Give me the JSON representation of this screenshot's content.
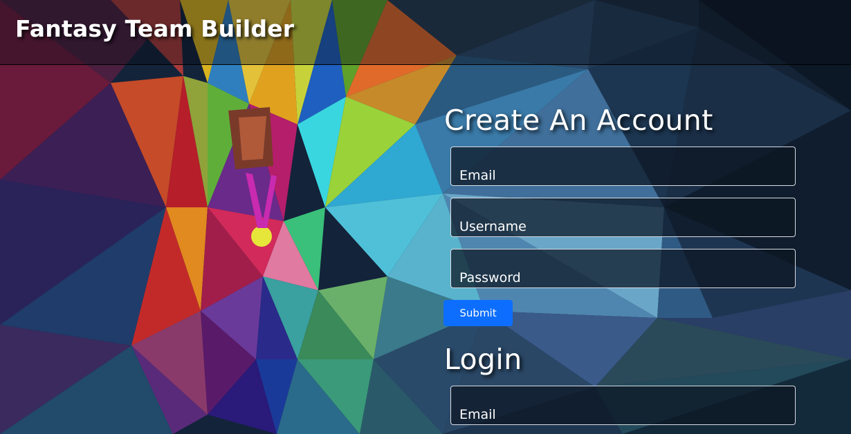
{
  "header": {
    "title": "Fantasy Team Builder"
  },
  "signup": {
    "title": "Create An Account",
    "email_placeholder": "Email",
    "username_placeholder": "Username",
    "password_placeholder": "Password",
    "submit_label": "Submit"
  },
  "login": {
    "title": "Login",
    "email_placeholder": "Email"
  },
  "colors": {
    "accent": "#0d6efd",
    "text": "#ffffff",
    "field_border": "#d8dde4",
    "header_border": "#000000"
  },
  "background": {
    "icon": "low-poly-athlete-illustration"
  }
}
